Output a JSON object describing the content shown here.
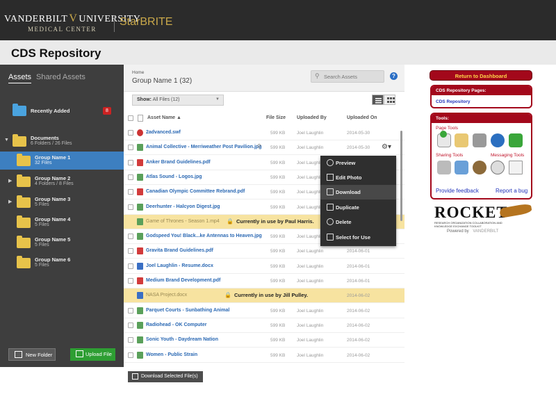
{
  "header": {
    "brand_line1": "VANDERBILT",
    "brand_mark": "V",
    "brand_line1b": "UNIVERSITY",
    "brand_line2": "MEDICAL CENTER",
    "app": "StarBRITE"
  },
  "page_title": "CDS Repository",
  "sidebar": {
    "tabs": [
      {
        "label": "Assets",
        "active": true
      },
      {
        "label": "Shared Assets",
        "active": false
      }
    ],
    "recently_added": {
      "label": "Recently Added",
      "count": "8"
    },
    "tree": [
      {
        "name": "Documents",
        "sub": "6 Folders / 26 Files",
        "expanded": true,
        "selected": false
      },
      {
        "name": "Group Name 1",
        "sub": "32 Files",
        "selected": true
      },
      {
        "name": "Group Name 2",
        "sub": "4 Folders / 8 Files",
        "selected": false
      },
      {
        "name": "Group Name 3",
        "sub": "5 Files",
        "selected": false
      },
      {
        "name": "Group Name 4",
        "sub": "5 Files",
        "selected": false
      },
      {
        "name": "Group Name 5",
        "sub": "5 Files",
        "selected": false
      },
      {
        "name": "Group Name  6",
        "sub": "5 Files",
        "selected": false
      }
    ],
    "new_folder_label": "New Folder",
    "upload_label": "Upload File"
  },
  "main": {
    "breadcrumb_home": "Home",
    "folder_title": "Group Name 1 (32)",
    "search_placeholder": "Search Assets",
    "help_label": "?",
    "filter": {
      "prefix": "Show:",
      "value": "All Files (12)"
    },
    "columns": {
      "name": "Asset Name ▲",
      "size": "File Size",
      "by": "Uploaded By",
      "on": "Uploaded On"
    },
    "files": [
      {
        "name": "2advanced.swf",
        "type": "swf",
        "size": "599 KB",
        "by": "Joel Laughlin",
        "on": "2014-05-30",
        "locked": false
      },
      {
        "name": "Animal Collective - Merriweather Post Pavilion.jpg",
        "type": "img",
        "size": "599 KB",
        "by": "Joel Laughlin",
        "on": "2014-05-30",
        "locked": false
      },
      {
        "name": "Anker Brand Guidelines.pdf",
        "type": "pdf",
        "size": "599 KB",
        "by": "Joel Laughlin",
        "on": "",
        "locked": false
      },
      {
        "name": "Atlas Sound - Logos.jpg",
        "type": "img",
        "size": "599 KB",
        "by": "Joel Laughlin",
        "on": "",
        "locked": false
      },
      {
        "name": "Canadian Olympic Committee Rebrand.pdf",
        "type": "pdf",
        "size": "599 KB",
        "by": "Joel Laughlin",
        "on": "",
        "locked": false
      },
      {
        "name": "Deerhunter - Halcyon Digest.jpg",
        "type": "img",
        "size": "599 KB",
        "by": "Joel Laughlin",
        "on": "",
        "locked": false
      },
      {
        "name": "Game of Thrones - Season 1.mp4",
        "type": "img",
        "size": "",
        "by": "",
        "on": "",
        "locked": true,
        "lock_msg": "Currently in use by Paul Harris."
      },
      {
        "name": "Godspeed You! Black...ke Antennas to Heaven.jpg",
        "type": "img",
        "size": "599 KB",
        "by": "Joel Laughlin",
        "on": "",
        "locked": false
      },
      {
        "name": "Gravita Brand Guidelines.pdf",
        "type": "pdf",
        "size": "599 KB",
        "by": "Joel Laughlin",
        "on": "2014-06-01",
        "locked": false
      },
      {
        "name": "Joel Laughlin - Resume.docx",
        "type": "doc",
        "size": "599 KB",
        "by": "Joel Laughlin",
        "on": "2014-06-01",
        "locked": false
      },
      {
        "name": "Medium Brand Development.pdf",
        "type": "pdf",
        "size": "599 KB",
        "by": "Joel Laughlin",
        "on": "2014-06-01",
        "locked": false
      },
      {
        "name": "NASA Project.docx",
        "type": "doc",
        "size": "",
        "by": "",
        "on": "2014-06-02",
        "locked": true,
        "lock_msg": "Currently in use by Jill Pulley."
      },
      {
        "name": "Parquet Courts - Sunbathing Animal",
        "type": "img",
        "size": "599 KB",
        "by": "Joel Laughlin",
        "on": "2014-06-02",
        "locked": false
      },
      {
        "name": "Radiohead - OK Computer",
        "type": "img",
        "size": "599 KB",
        "by": "Joel Laughlin",
        "on": "2014-06-02",
        "locked": false
      },
      {
        "name": "Sonic Youth - Daydream Nation",
        "type": "img",
        "size": "599 KB",
        "by": "Joel Laughlin",
        "on": "2014-06-02",
        "locked": false
      },
      {
        "name": "Women - Public Strain",
        "type": "img",
        "size": "599 KB",
        "by": "Joel Laughlin",
        "on": "2014-06-02",
        "locked": false
      }
    ],
    "context_menu": [
      "Preview",
      "Edit Photo",
      "Download",
      "Duplicate",
      "Delete",
      "Select for Use"
    ],
    "download_selected_label": "Download Selected File(s)"
  },
  "right": {
    "return_label": "Return to Dashboard",
    "pages_header": "CDS Repository Pages:",
    "pages_link": "CDS Repository",
    "tools_header": "Tools:",
    "page_tools_label": "Page Tools",
    "sharing_tools_label": "Sharing Tools",
    "messaging_tools_label": "Messaging Tools",
    "feedback_label": "Provide feedback",
    "bug_label": "Report a bug",
    "rocket_title": "ROCKET",
    "rocket_sub": "RESEARCH ORGANIZATION COLLABORATION AND KNOWLEDGE EXCHANGE TOOLKIT",
    "powered_by": "Powered by",
    "powered_brand": "VANDERBILT"
  },
  "colors": {
    "accent_red": "#a3081b",
    "link_blue": "#2a68b3",
    "selection_blue": "#3d7fc0",
    "lock_yellow": "#f7e3a0",
    "upload_green": "#2e9e33"
  }
}
